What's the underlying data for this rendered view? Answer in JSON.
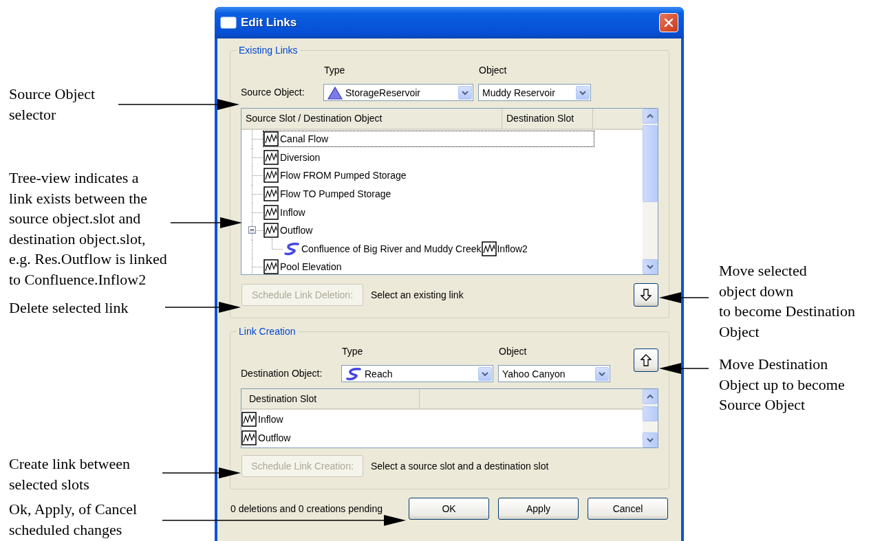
{
  "annotations_left": [
    {
      "text": "Source Object\nselector"
    },
    {
      "text": "Tree-view indicates a\nlink exists between the\nsource object.slot and\ndestination object.slot,\ne.g. Res.Outflow is linked\nto Confluence.Inflow2"
    },
    {
      "text": "Delete selected link"
    },
    {
      "text": "Create link between\nselected slots"
    },
    {
      "text": "Ok, Apply, of Cancel\nscheduled changes"
    }
  ],
  "annotations_right": [
    {
      "text": "Move selected\nobject down\nto become Destination\nObject"
    },
    {
      "text": "Move Destination\nObject up to become\nSource Object"
    }
  ],
  "window": {
    "title": "Edit Links"
  },
  "existing_links": {
    "title": "Existing Links",
    "type_header": "Type",
    "object_header": "Object",
    "selector_label": "Source Object:",
    "type": {
      "kind": "reservoir",
      "value": "StorageReservoir"
    },
    "object": {
      "value": "Muddy Reservoir"
    },
    "tree": {
      "columns": [
        "Source Slot / Destination Object",
        "Destination Slot"
      ],
      "items": [
        {
          "label": "Canal Flow",
          "focused": true,
          "expanded": false
        },
        {
          "label": "Diversion",
          "focused": false,
          "expanded": false
        },
        {
          "label": "Flow FROM Pumped Storage",
          "focused": false,
          "expanded": false
        },
        {
          "label": "Flow TO Pumped Storage",
          "focused": false,
          "expanded": false
        },
        {
          "label": "Inflow",
          "focused": false,
          "expanded": false
        },
        {
          "label": "Outflow",
          "focused": false,
          "expanded": true,
          "children": [
            {
              "kind": "reach",
              "label": "Confluence of Big River and Muddy Creek",
              "slot": "Inflow2"
            }
          ]
        },
        {
          "label": "Pool Elevation",
          "focused": false,
          "expanded": false
        }
      ]
    },
    "delete_button": {
      "label": "Schedule Link Deletion:",
      "disabled": true
    },
    "hint": "Select an existing link"
  },
  "link_creation": {
    "title": "Link Creation",
    "type_header": "Type",
    "object_header": "Object",
    "selector_label": "Destination Object:",
    "type": {
      "kind": "reach",
      "value": "Reach"
    },
    "object": {
      "value": "Yahoo Canyon"
    },
    "slot_list": {
      "columns": [
        "Destination Slot"
      ],
      "items": [
        "Inflow",
        "Outflow"
      ]
    },
    "create_button": {
      "label": "Schedule Link Creation:",
      "disabled": true
    },
    "hint": "Select a source slot and a destination slot"
  },
  "status": "0 deletions and 0 creations pending",
  "buttons": [
    "OK",
    "Apply",
    "Cancel"
  ]
}
